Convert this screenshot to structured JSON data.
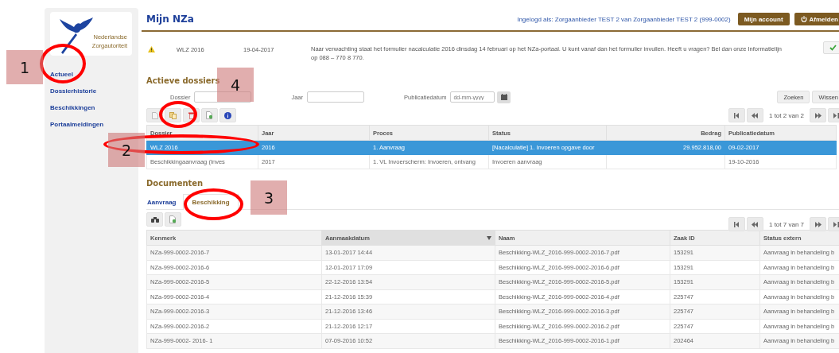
{
  "sidebar": {
    "logo": {
      "line1": "Nederlandse",
      "line2": "Zorgautoriteit"
    },
    "items": [
      {
        "label": "Actueel"
      },
      {
        "label": "Dossierhistorie"
      },
      {
        "label": "Beschikkingen"
      },
      {
        "label": "Portaalmeldingen"
      }
    ]
  },
  "header": {
    "title": "Mijn NZa",
    "logged_in": "Ingelogd als: Zorgaanbieder TEST 2 van Zorgaanbieder TEST 2 (999-0002)",
    "buttons": [
      {
        "label": "Mijn account",
        "kind": "plain"
      },
      {
        "label": "Afmelden",
        "kind": "power"
      }
    ]
  },
  "notification": {
    "dossier": "WLZ 2016",
    "date": "19-04-2017",
    "message": "Naar verwachting staat het formulier nacalculatie 2016 dinsdag 14 februari op het NZa-portaal. U kunt vanaf dan het formulier invullen. Heeft u vragen? Bel dan onze Informatielijn op 088 – 770 8 770."
  },
  "active_dossiers": {
    "heading": "Actieve dossiers",
    "filters": [
      {
        "label": "Dossier",
        "kind": "text"
      },
      {
        "label": "Jaar",
        "kind": "text"
      },
      {
        "label": "Publicatiedatum",
        "kind": "date",
        "placeholder": "dd-mm-yyyy"
      }
    ],
    "buttons": [
      "Zoeken",
      "Wissen"
    ],
    "pager": "1 tot 2 van 2",
    "columns": [
      {
        "label": "Dossier",
        "kind": "text"
      },
      {
        "label": "Jaar",
        "kind": "text"
      },
      {
        "label": "Proces",
        "kind": "text"
      },
      {
        "label": "Status",
        "kind": "text"
      },
      {
        "label": "Bedrag",
        "kind": "amount"
      },
      {
        "label": "Publicatiedatum",
        "kind": "text"
      }
    ],
    "rows": [
      {
        "selected": true,
        "cells": [
          "WLZ 2016",
          "2016",
          "1. Aanvraag",
          "[Nacalculatie] 1. Invoeren opgave door",
          "29.952.818,00",
          "09-02-2017"
        ]
      },
      {
        "selected": false,
        "cells": [
          "Beschikkingaanvraag (Inves",
          "2017",
          "1. VL Invoerscherm: Invoeren, ontvang",
          "Invoeren aanvraag",
          "",
          "19-10-2016"
        ]
      }
    ]
  },
  "documents": {
    "heading": "Documenten",
    "tabs": [
      {
        "label": "Aanvraag",
        "selected": false
      },
      {
        "label": "Beschikking",
        "selected": true
      }
    ],
    "pager": "1 tot 7 van 7",
    "columns": [
      {
        "label": "Kenmerk",
        "sorted": false
      },
      {
        "label": "Aanmaakdatum",
        "sorted": true
      },
      {
        "label": "Naam",
        "sorted": false
      },
      {
        "label": "Zaak ID",
        "sorted": false
      },
      {
        "label": "Status extern",
        "sorted": false
      }
    ],
    "rows": [
      [
        "NZa-999-0002-2016-7",
        "13-01-2017 14:44",
        "Beschikking-WLZ_2016-999-0002-2016-7.pdf",
        "153291",
        "Aanvraag in behandeling b"
      ],
      [
        "NZa-999-0002-2016-6",
        "12-01-2017 17:09",
        "Beschikking-WLZ_2016-999-0002-2016-6.pdf",
        "153291",
        "Aanvraag in behandeling b"
      ],
      [
        "NZa-999-0002-2016-5",
        "22-12-2016 13:54",
        "Beschikking-WLZ_2016-999-0002-2016-5.pdf",
        "153291",
        "Aanvraag in behandeling b"
      ],
      [
        "NZa-999-0002-2016-4",
        "21-12-2016 15:39",
        "Beschikking-WLZ_2016-999-0002-2016-4.pdf",
        "225747",
        "Aanvraag in behandeling b"
      ],
      [
        "NZa-999-0002-2016-3",
        "21-12-2016 13:46",
        "Beschikking-WLZ_2016-999-0002-2016-3.pdf",
        "225747",
        "Aanvraag in behandeling b"
      ],
      [
        "NZa-999-0002-2016-2",
        "21-12-2016 12:17",
        "Beschikking-WLZ_2016-999-0002-2016-2.pdf",
        "225747",
        "Aanvraag in behandeling b"
      ],
      [
        "NZa-999-0002- 2016- 1",
        "07-09-2016 10:52",
        "Beschikking-WLZ_2016-999-0002-2016-1.pdf",
        "202464",
        "Aanvraag in behandeling b"
      ]
    ]
  },
  "annotations": [
    {
      "number": "1"
    },
    {
      "number": "2"
    },
    {
      "number": "3"
    },
    {
      "number": "4"
    }
  ]
}
